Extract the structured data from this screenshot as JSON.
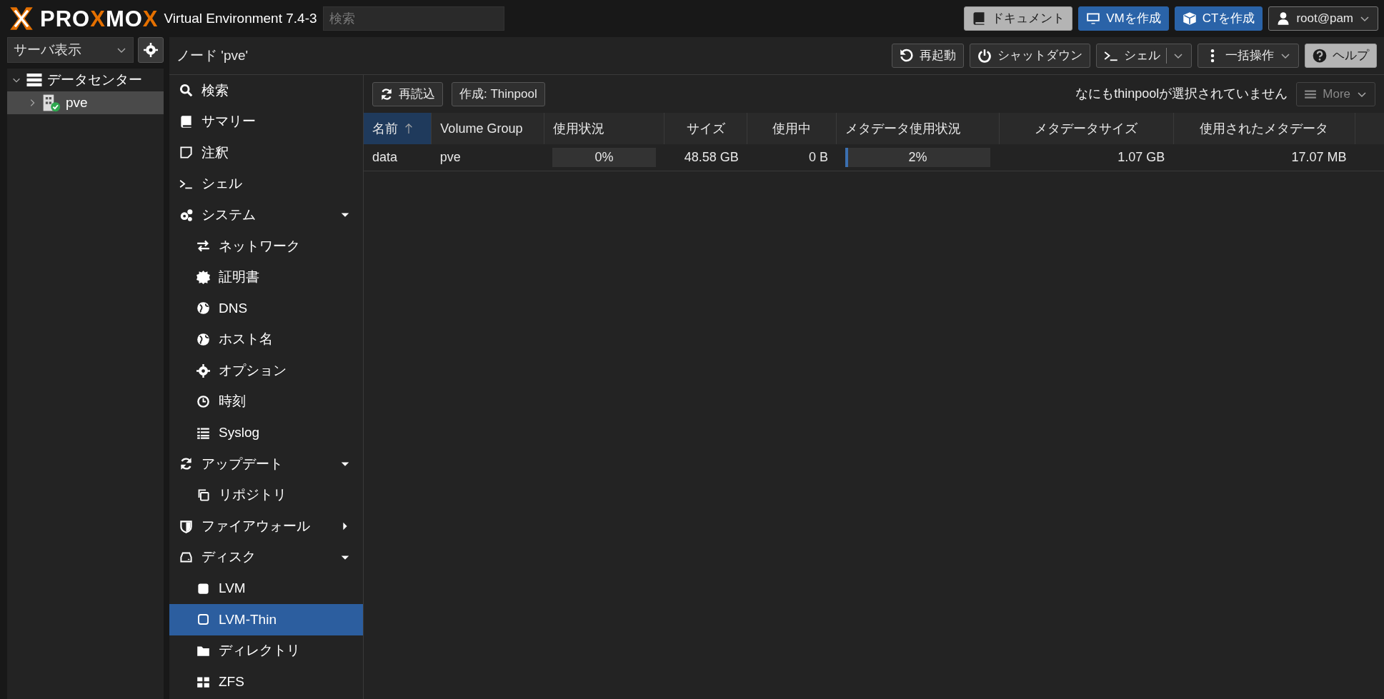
{
  "header": {
    "logo_parts": [
      "PRO",
      "X",
      "MO",
      "X"
    ],
    "version": "Virtual Environment 7.4-3",
    "search": {
      "placeholder": "検索"
    },
    "buttons": [
      {
        "label": "ドキュメント",
        "kind": "light"
      },
      {
        "label": "VMを作成",
        "kind": "primary"
      },
      {
        "label": "CTを作成",
        "kind": "primary"
      },
      {
        "label": "root@pam",
        "kind": "user"
      }
    ]
  },
  "sidebar": {
    "view_select": "サーバ表示",
    "tree": [
      {
        "label": "データセンター",
        "expanded": true,
        "selected": false,
        "children": [
          {
            "label": "pve",
            "expanded": false,
            "selected": true
          }
        ]
      }
    ]
  },
  "node_panel": {
    "title": "ノード 'pve'",
    "toolbar": [
      {
        "label": "再起動",
        "kind": "plain"
      },
      {
        "label": "シャットダウン",
        "kind": "plain"
      },
      {
        "label": "シェル",
        "kind": "split"
      },
      {
        "label": "一括操作",
        "kind": "menu"
      },
      {
        "label": "ヘルプ",
        "kind": "light"
      }
    ]
  },
  "menu": [
    {
      "label": "検索",
      "selected": false
    },
    {
      "label": "サマリー",
      "selected": false
    },
    {
      "label": "注釈",
      "selected": false
    },
    {
      "label": "シェル",
      "selected": false
    },
    {
      "label": "システム",
      "selected": false,
      "expanded": true,
      "children": [
        {
          "label": "ネットワーク",
          "selected": false
        },
        {
          "label": "証明書",
          "selected": false
        },
        {
          "label": "DNS",
          "selected": false
        },
        {
          "label": "ホスト名",
          "selected": false
        },
        {
          "label": "オプション",
          "selected": false
        },
        {
          "label": "時刻",
          "selected": false
        },
        {
          "label": "Syslog",
          "selected": false
        }
      ]
    },
    {
      "label": "アップデート",
      "selected": false,
      "expanded": true,
      "children": [
        {
          "label": "リポジトリ",
          "selected": false
        }
      ]
    },
    {
      "label": "ファイアウォール",
      "selected": false,
      "expanded": false
    },
    {
      "label": "ディスク",
      "selected": false,
      "expanded": true,
      "children": [
        {
          "label": "LVM",
          "selected": false
        },
        {
          "label": "LVM-Thin",
          "selected": true
        },
        {
          "label": "ディレクトリ",
          "selected": false
        },
        {
          "label": "ZFS",
          "selected": false
        }
      ]
    }
  ],
  "content": {
    "toolbar": [
      {
        "label": "再読込",
        "kind": "reload"
      },
      {
        "label": "作成: Thinpool",
        "kind": "plain"
      }
    ],
    "selection_status": "なにもthinpoolが選択されていません",
    "more_button": {
      "label": "More",
      "disabled": true
    },
    "table": {
      "columns": [
        {
          "label": "名前",
          "sorted": true
        },
        {
          "label": "Volume Group",
          "sorted": false
        },
        {
          "label": "使用状況",
          "sorted": false
        },
        {
          "label": "サイズ",
          "sorted": false
        },
        {
          "label": "使用中",
          "sorted": false
        },
        {
          "label": "メタデータ使用状況",
          "sorted": false
        },
        {
          "label": "メタデータサイズ",
          "sorted": false
        },
        {
          "label": "使用されたメタデータ",
          "sorted": false
        }
      ],
      "rows": [
        {
          "name": "data",
          "volume_group": "pve",
          "usage": {
            "level": 0,
            "reading": "0%"
          },
          "size": "48.58 GB",
          "used": "0 B",
          "metadata_usage": {
            "level": 0.02,
            "reading": "2%"
          },
          "metadata_size": "1.07 GB",
          "metadata_used": "17.07 MB"
        }
      ]
    }
  }
}
